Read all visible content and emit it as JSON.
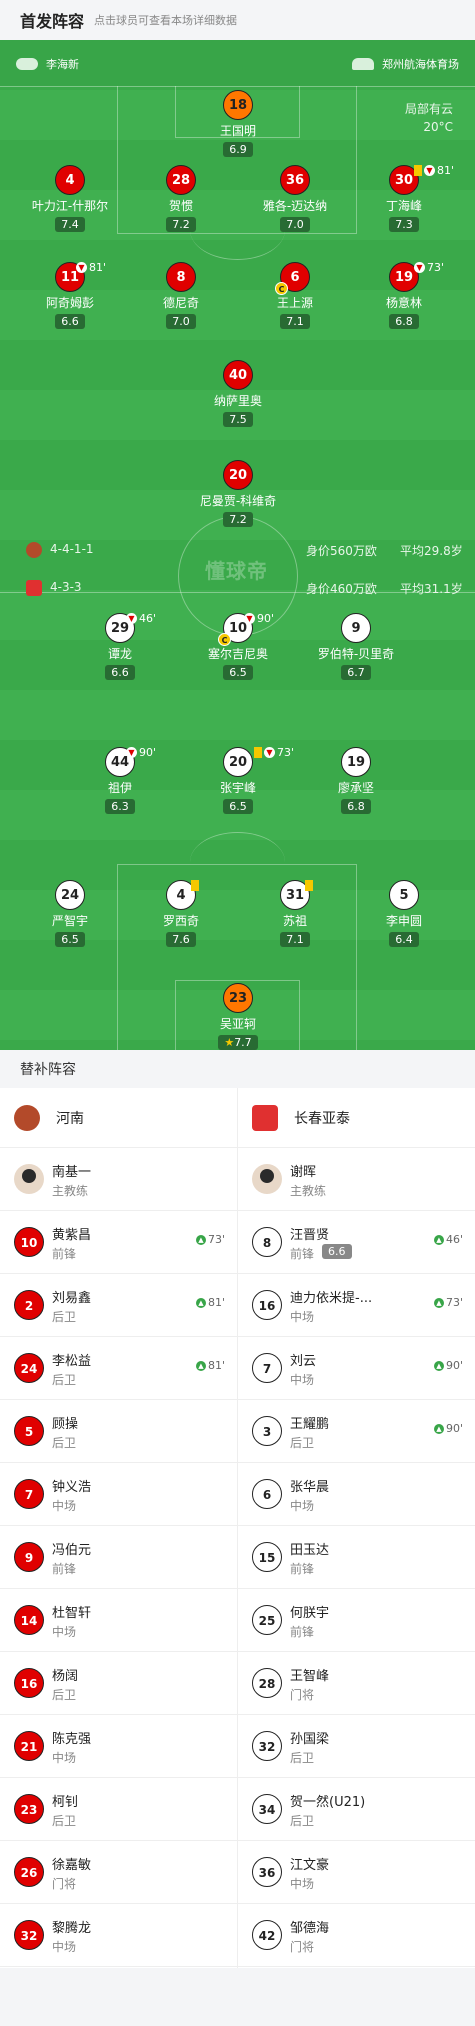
{
  "header": {
    "title": "首发阵容",
    "subtitle": "点击球员可查看本场详细数据"
  },
  "info": {
    "referee": "李海新",
    "stadium": "郑州航海体育场",
    "weather": "局部有云",
    "temperature": "20°C"
  },
  "watermark": "懂球帝",
  "home_players": [
    {
      "num": "18",
      "name": "王国明",
      "rating": "6.9"
    },
    {
      "num": "4",
      "name": "叶力江-什那尔",
      "rating": "7.4"
    },
    {
      "num": "28",
      "name": "贺惯",
      "rating": "7.2"
    },
    {
      "num": "36",
      "name": "雅各-迈达纳",
      "rating": "7.0"
    },
    {
      "num": "30",
      "name": "丁海峰",
      "rating": "7.3",
      "sub": "81'"
    },
    {
      "num": "11",
      "name": "阿奇姆彭",
      "rating": "6.6",
      "sub": "81'"
    },
    {
      "num": "8",
      "name": "德尼奇",
      "rating": "7.0"
    },
    {
      "num": "6",
      "name": "王上源",
      "rating": "7.1",
      "captain": "C"
    },
    {
      "num": "19",
      "name": "杨意林",
      "rating": "6.8",
      "sub": "73'"
    },
    {
      "num": "40",
      "name": "纳萨里奥",
      "rating": "7.5"
    },
    {
      "num": "20",
      "name": "尼曼贾-科维奇",
      "rating": "7.2"
    }
  ],
  "away_players": [
    {
      "num": "29",
      "name": "谭龙",
      "rating": "6.6",
      "sub": "46'"
    },
    {
      "num": "10",
      "name": "塞尔吉尼奥",
      "rating": "6.5",
      "sub": "90'",
      "captain": "C"
    },
    {
      "num": "9",
      "name": "罗伯特-贝里奇",
      "rating": "6.7"
    },
    {
      "num": "44",
      "name": "祖伊",
      "rating": "6.3",
      "sub": "90'"
    },
    {
      "num": "20",
      "name": "张宇峰",
      "rating": "6.5",
      "sub": "73'"
    },
    {
      "num": "19",
      "name": "廖承坚",
      "rating": "6.8"
    },
    {
      "num": "24",
      "name": "严智宇",
      "rating": "6.5"
    },
    {
      "num": "4",
      "name": "罗西奇",
      "rating": "7.6"
    },
    {
      "num": "31",
      "name": "苏祖",
      "rating": "7.1"
    },
    {
      "num": "5",
      "name": "李申圆",
      "rating": "6.4"
    },
    {
      "num": "23",
      "name": "吴亚轲",
      "rating": "7.7"
    }
  ],
  "formation": {
    "home": {
      "shape": "4-4-1-1",
      "value": "身价560万欧",
      "avg_age": "平均29.8岁"
    },
    "away": {
      "shape": "4-3-3",
      "value": "身价460万欧",
      "avg_age": "平均31.1岁"
    }
  },
  "subs_title": "替补阵容",
  "home_team": "河南",
  "away_team": "长春亚泰",
  "home_coach": {
    "name": "南基一",
    "role": "主教练"
  },
  "away_coach": {
    "name": "谢晖",
    "role": "主教练"
  },
  "home_subs": [
    {
      "num": "10",
      "name": "黄紫昌",
      "pos": "前锋",
      "min": "73'"
    },
    {
      "num": "2",
      "name": "刘易鑫",
      "pos": "后卫",
      "min": "81'"
    },
    {
      "num": "24",
      "name": "李松益",
      "pos": "后卫",
      "min": "81'"
    },
    {
      "num": "5",
      "name": "顾操",
      "pos": "后卫"
    },
    {
      "num": "7",
      "name": "钟义浩",
      "pos": "中场"
    },
    {
      "num": "9",
      "name": "冯伯元",
      "pos": "前锋"
    },
    {
      "num": "14",
      "name": "杜智轩",
      "pos": "中场"
    },
    {
      "num": "16",
      "name": "杨阔",
      "pos": "后卫"
    },
    {
      "num": "21",
      "name": "陈克强",
      "pos": "中场"
    },
    {
      "num": "23",
      "name": "柯钊",
      "pos": "后卫"
    },
    {
      "num": "26",
      "name": "徐嘉敏",
      "pos": "门将"
    },
    {
      "num": "32",
      "name": "黎腾龙",
      "pos": "中场"
    }
  ],
  "away_subs": [
    {
      "num": "8",
      "name": "汪晋贤",
      "pos": "前锋",
      "rating": "6.6",
      "min": "46'"
    },
    {
      "num": "16",
      "name": "迪力依米提-...",
      "pos": "中场",
      "min": "73'"
    },
    {
      "num": "7",
      "name": "刘云",
      "pos": "中场",
      "min": "90'"
    },
    {
      "num": "3",
      "name": "王耀鹏",
      "pos": "后卫",
      "min": "90'"
    },
    {
      "num": "6",
      "name": "张华晨",
      "pos": "中场"
    },
    {
      "num": "15",
      "name": "田玉达",
      "pos": "前锋"
    },
    {
      "num": "25",
      "name": "何朕宇",
      "pos": "前锋"
    },
    {
      "num": "28",
      "name": "王智峰",
      "pos": "门将"
    },
    {
      "num": "32",
      "name": "孙国梁",
      "pos": "后卫"
    },
    {
      "num": "34",
      "name": "贺一然(U21)",
      "pos": "后卫"
    },
    {
      "num": "36",
      "name": "江文豪",
      "pos": "中场"
    },
    {
      "num": "42",
      "name": "邹德海",
      "pos": "门将"
    }
  ],
  "colors": {
    "pitch": "#3aa94a",
    "home": "#e00000",
    "gk": "#ff7700",
    "card": "#f5c800"
  }
}
